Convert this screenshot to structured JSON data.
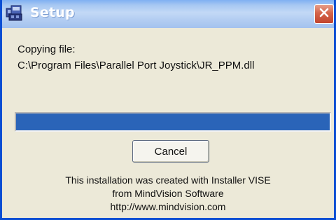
{
  "window": {
    "title": "Setup",
    "title_icon": "setup-installer-icon",
    "close_icon": "close-icon"
  },
  "status": {
    "caption": "Copying file:",
    "file_path": "C:\\Program Files\\Parallel Port Joystick\\JR_PPM.dll"
  },
  "progress": {
    "fraction": 1.0
  },
  "buttons": {
    "cancel_label": "Cancel"
  },
  "credits": {
    "line1": "This installation was created with Installer VISE",
    "line2": "from MindVision Software",
    "line3": "http://www.mindvision.com"
  },
  "colors": {
    "title_gradient_top": "#7fb0f2",
    "frame": "#0a4ed3",
    "progress_fill": "#2a64b8",
    "close_button": "#d4644a",
    "dialog_bg": "#ece9d8"
  }
}
